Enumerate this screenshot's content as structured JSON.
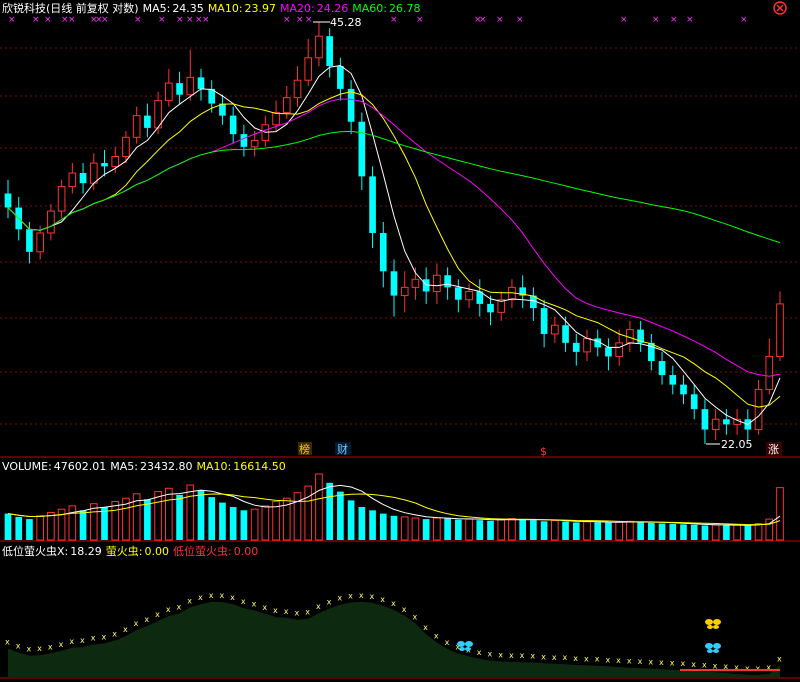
{
  "header": {
    "title": "欣锐科技(日线 前复权 对数)",
    "ma5_label": "MA5:",
    "ma5_value": "24.35",
    "ma10_label": "MA10:",
    "ma10_value": "23.97",
    "ma20_label": "MA20:",
    "ma20_value": "24.26",
    "ma60_label": "MA60:",
    "ma60_value": "26.78"
  },
  "volume_header": {
    "label": "VOLUME:",
    "value": "47602.01",
    "ma5_label": "MA5:",
    "ma5_value": "23432.80",
    "ma10_label": "MA10:",
    "ma10_value": "16614.50"
  },
  "indicator_header": {
    "name1": "低位萤火虫X",
    "sep": ":",
    "value1": "18.29",
    "name2": "萤火虫",
    "value2": "0.00",
    "name3": "低位萤火虫",
    "value3": "0.00"
  },
  "annotations": {
    "high": "45.28",
    "low": "22.05",
    "event1": "榜",
    "event2": "财",
    "event3": "$",
    "event4": "涨"
  },
  "colors": {
    "up": "#ff3232",
    "down": "#00ffff",
    "ma5": "#ffffff",
    "ma10": "#ffff00",
    "ma20": "#ff00ff",
    "ma60": "#00ff00",
    "divider": "#c00000",
    "area": "#0d2a10"
  },
  "chart_data": [
    {
      "type": "candlestick",
      "title": "欣锐科技(日线 前复权 对数)",
      "scale": "log",
      "high_marker": 45.28,
      "low_marker": 22.05,
      "candles": [
        [
          33.8,
          33.0,
          34.6,
          32.4
        ],
        [
          33.0,
          31.8,
          33.6,
          31.2
        ],
        [
          31.8,
          30.6,
          32.2,
          30.0
        ],
        [
          30.6,
          31.6,
          32.0,
          30.2
        ],
        [
          31.6,
          32.8,
          33.2,
          31.2
        ],
        [
          32.8,
          34.2,
          34.6,
          32.4
        ],
        [
          34.2,
          35.0,
          35.6,
          33.8
        ],
        [
          35.0,
          34.4,
          35.6,
          33.8
        ],
        [
          34.4,
          35.6,
          36.2,
          34.0
        ],
        [
          35.6,
          35.4,
          36.4,
          34.8
        ],
        [
          35.4,
          36.0,
          36.6,
          35.0
        ],
        [
          36.0,
          37.2,
          37.6,
          35.6
        ],
        [
          37.2,
          38.6,
          39.2,
          36.8
        ],
        [
          38.6,
          37.8,
          39.4,
          37.2
        ],
        [
          37.8,
          39.6,
          40.2,
          37.4
        ],
        [
          39.6,
          40.8,
          41.8,
          39.2
        ],
        [
          40.8,
          40.0,
          41.6,
          39.4
        ],
        [
          40.0,
          41.2,
          43.2,
          39.6
        ],
        [
          41.2,
          40.4,
          41.8,
          39.6
        ],
        [
          40.4,
          39.4,
          41.0,
          38.8
        ],
        [
          39.4,
          38.6,
          40.0,
          38.0
        ],
        [
          38.6,
          37.4,
          39.2,
          36.8
        ],
        [
          37.4,
          36.6,
          38.0,
          36.0
        ],
        [
          36.6,
          37.0,
          37.6,
          36.0
        ],
        [
          37.0,
          38.0,
          38.6,
          36.6
        ],
        [
          38.0,
          38.8,
          39.6,
          37.6
        ],
        [
          38.8,
          39.8,
          40.6,
          38.4
        ],
        [
          39.8,
          41.0,
          42.0,
          39.2
        ],
        [
          41.0,
          42.6,
          44.0,
          40.6
        ],
        [
          42.6,
          44.2,
          45.28,
          42.0
        ],
        [
          44.2,
          42.0,
          44.8,
          41.2
        ],
        [
          42.0,
          40.4,
          42.6,
          39.6
        ],
        [
          40.4,
          38.2,
          41.0,
          37.4
        ],
        [
          38.2,
          34.8,
          38.8,
          34.0
        ],
        [
          34.8,
          31.6,
          35.4,
          30.8
        ],
        [
          31.6,
          29.6,
          32.2,
          28.8
        ],
        [
          29.6,
          28.4,
          30.2,
          27.4
        ],
        [
          28.4,
          28.8,
          29.6,
          27.6
        ],
        [
          28.8,
          29.2,
          29.8,
          28.2
        ],
        [
          29.2,
          28.6,
          29.8,
          28.0
        ],
        [
          28.6,
          29.4,
          30.0,
          28.0
        ],
        [
          29.4,
          28.8,
          29.8,
          28.2
        ],
        [
          28.8,
          28.2,
          29.2,
          27.6
        ],
        [
          28.2,
          28.6,
          29.0,
          27.8
        ],
        [
          28.6,
          28.0,
          29.2,
          27.4
        ],
        [
          28.0,
          27.6,
          28.4,
          27.0
        ],
        [
          27.6,
          28.2,
          28.6,
          27.2
        ],
        [
          28.2,
          28.8,
          29.2,
          27.8
        ],
        [
          28.8,
          28.4,
          29.4,
          27.8
        ],
        [
          28.4,
          27.8,
          28.8,
          27.2
        ],
        [
          27.8,
          26.6,
          28.2,
          26.0
        ],
        [
          26.6,
          27.0,
          27.4,
          26.2
        ],
        [
          27.0,
          26.2,
          27.4,
          25.8
        ],
        [
          26.2,
          25.8,
          26.6,
          25.2
        ],
        [
          25.8,
          26.4,
          26.8,
          25.4
        ],
        [
          26.4,
          26.0,
          26.8,
          25.6
        ],
        [
          26.0,
          25.6,
          26.4,
          25.0
        ],
        [
          25.6,
          26.2,
          26.8,
          25.2
        ],
        [
          26.2,
          26.8,
          27.2,
          25.8
        ],
        [
          26.8,
          26.2,
          27.2,
          25.8
        ],
        [
          26.2,
          25.4,
          26.6,
          25.0
        ],
        [
          25.4,
          24.8,
          25.8,
          24.4
        ],
        [
          24.8,
          24.4,
          25.2,
          24.0
        ],
        [
          24.4,
          24.0,
          24.8,
          23.6
        ],
        [
          24.0,
          23.4,
          24.4,
          23.0
        ],
        [
          23.4,
          22.6,
          23.8,
          22.05
        ],
        [
          22.6,
          23.0,
          23.4,
          22.2
        ],
        [
          23.0,
          22.8,
          23.4,
          22.4
        ],
        [
          22.8,
          23.0,
          23.4,
          22.4
        ],
        [
          23.0,
          22.6,
          23.4,
          22.2
        ],
        [
          22.6,
          24.2,
          24.6,
          22.4
        ],
        [
          24.2,
          25.6,
          26.4,
          24.0
        ],
        [
          25.6,
          28.0,
          28.6,
          25.4
        ]
      ]
    },
    {
      "type": "bar",
      "title": "VOLUME",
      "values": [
        24000,
        21000,
        19000,
        22000,
        25000,
        28000,
        31000,
        27000,
        33000,
        30000,
        35000,
        38000,
        42000,
        37000,
        44000,
        47000,
        41000,
        50000,
        45000,
        39000,
        34000,
        30000,
        27000,
        28000,
        31000,
        35000,
        38000,
        43000,
        49000,
        60000,
        52000,
        44000,
        36000,
        30000,
        27000,
        24000,
        22000,
        21000,
        20000,
        19000,
        20000,
        19500,
        18500,
        19000,
        18000,
        17500,
        18500,
        19500,
        18800,
        18000,
        17000,
        17600,
        16800,
        16000,
        16600,
        16200,
        15800,
        16400,
        17000,
        16400,
        15600,
        15000,
        14600,
        14200,
        13800,
        13200,
        13600,
        13400,
        13600,
        13200,
        15000,
        19000,
        47602
      ]
    }
  ]
}
